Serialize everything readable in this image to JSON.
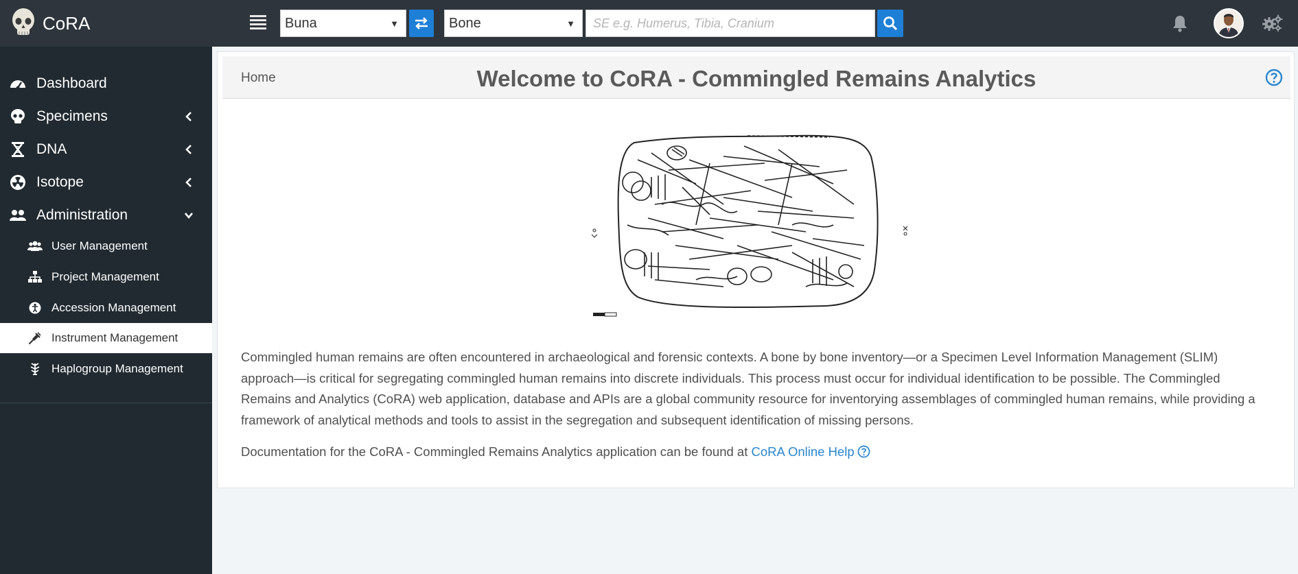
{
  "app": {
    "name": "CoRA"
  },
  "topbar": {
    "site_select": {
      "value": "Buna"
    },
    "bone_select": {
      "value": "Bone"
    },
    "search": {
      "placeholder": "SE e.g. Humerus, Tibia, Cranium",
      "value": ""
    },
    "icons": [
      "menu-icon",
      "swap-icon",
      "search-icon",
      "bell-icon",
      "avatar",
      "gears-icon"
    ]
  },
  "sidebar": {
    "items": [
      {
        "label": "Dashboard",
        "icon": "dashboard-icon"
      },
      {
        "label": "Specimens",
        "icon": "skull-icon"
      },
      {
        "label": "DNA",
        "icon": "dna-icon"
      },
      {
        "label": "Isotope",
        "icon": "radiation-icon"
      },
      {
        "label": "Administration",
        "icon": "users-icon"
      }
    ],
    "admin_items": [
      {
        "label": "User Management",
        "icon": "users-icon"
      },
      {
        "label": "Project Management",
        "icon": "sitemap-icon"
      },
      {
        "label": "Accession Management",
        "icon": "accession-icon"
      },
      {
        "label": "Instrument Management",
        "icon": "instrument-icon",
        "active": true
      },
      {
        "label": "Haplogroup Management",
        "icon": "haplogroup-icon"
      }
    ]
  },
  "content": {
    "breadcrumb": "Home",
    "title": "Welcome to CoRA - Commingled Remains Analytics",
    "paragraph1": "Commingled human remains are often encountered in archaeological and forensic contexts. A bone by bone inventory—or a Specimen Level Information Management (SLIM) approach—is critical for segregating commingled human remains into discrete individuals. This process must occur for individual identification to be possible. The Commingled Remains and Analytics (CoRA) web application, database and APIs are a global community resource for inventorying assemblages of commingled human remains, while providing a framework of analytical methods and tools to assist in the segregation and subsequent identification of missing persons.",
    "paragraph2_prefix": "Documentation for the CoRA - Commingled Remains Analytics application can be found at ",
    "help_link": "CoRA Online Help"
  },
  "colors": {
    "topbar": "#2e353c",
    "sidebar": "#212a30",
    "accent": "#1e7fd6",
    "link": "#2a86cf"
  }
}
